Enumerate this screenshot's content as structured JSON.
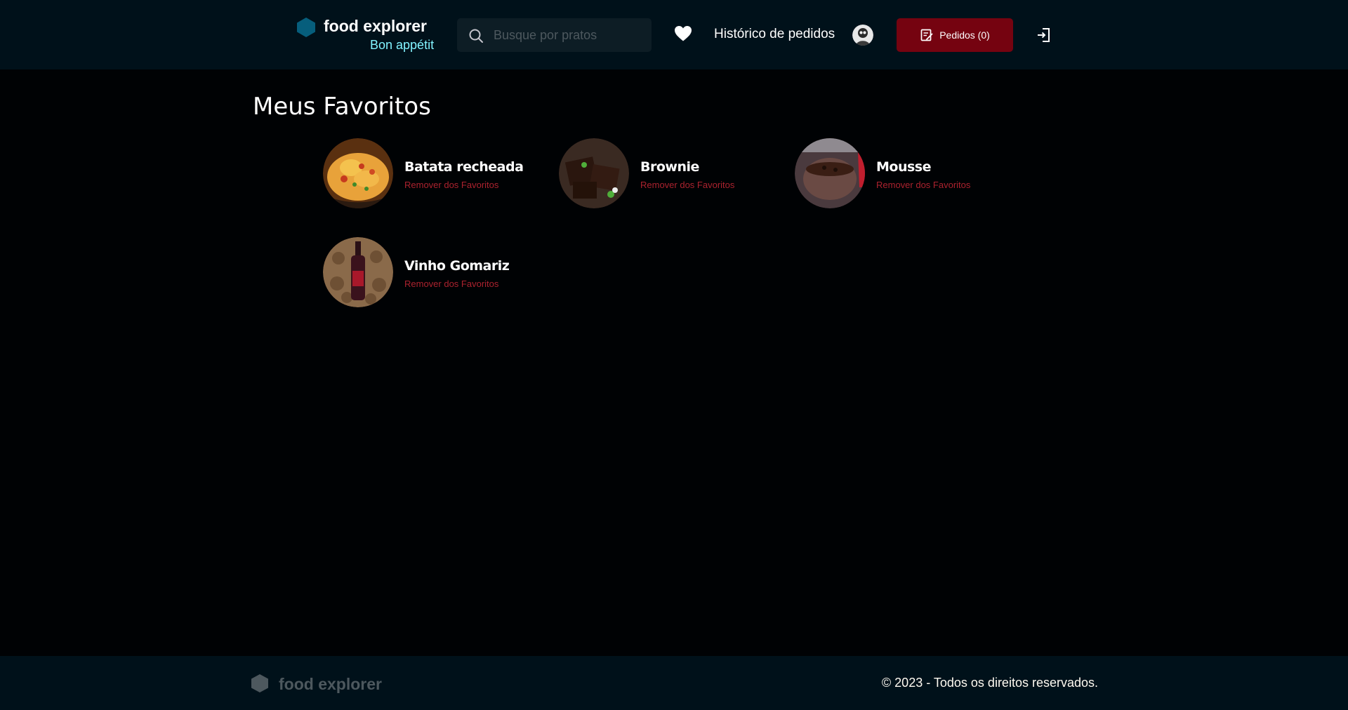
{
  "header": {
    "logo_title": "food explorer",
    "logo_subtitle": "Bon appétit",
    "search_placeholder": "Busque por pratos",
    "history_label": "Histórico de pedidos",
    "orders_label": "Pedidos (0)"
  },
  "main": {
    "title": "Meus Favoritos",
    "remove_label": "Remover dos Favoritos",
    "favorites": [
      {
        "name": "Batata recheada",
        "image": "loaded-potato-photo"
      },
      {
        "name": "Brownie",
        "image": "brownie-photo"
      },
      {
        "name": "Mousse",
        "image": "chocolate-mousse-photo"
      },
      {
        "name": "Vinho Gomariz",
        "image": "wine-bottle-photo"
      }
    ]
  },
  "footer": {
    "logo_title": "food explorer",
    "copyright": "© 2023 - Todos os direitos reservados."
  },
  "colors": {
    "background": "#000204",
    "header_bg": "#00111A",
    "accent_cyan": "#82F3FF",
    "logo_hex": "#065E7C",
    "orders_button": "#750310",
    "remove_link": "#AB222E",
    "footer_muted": "#4D585E"
  }
}
